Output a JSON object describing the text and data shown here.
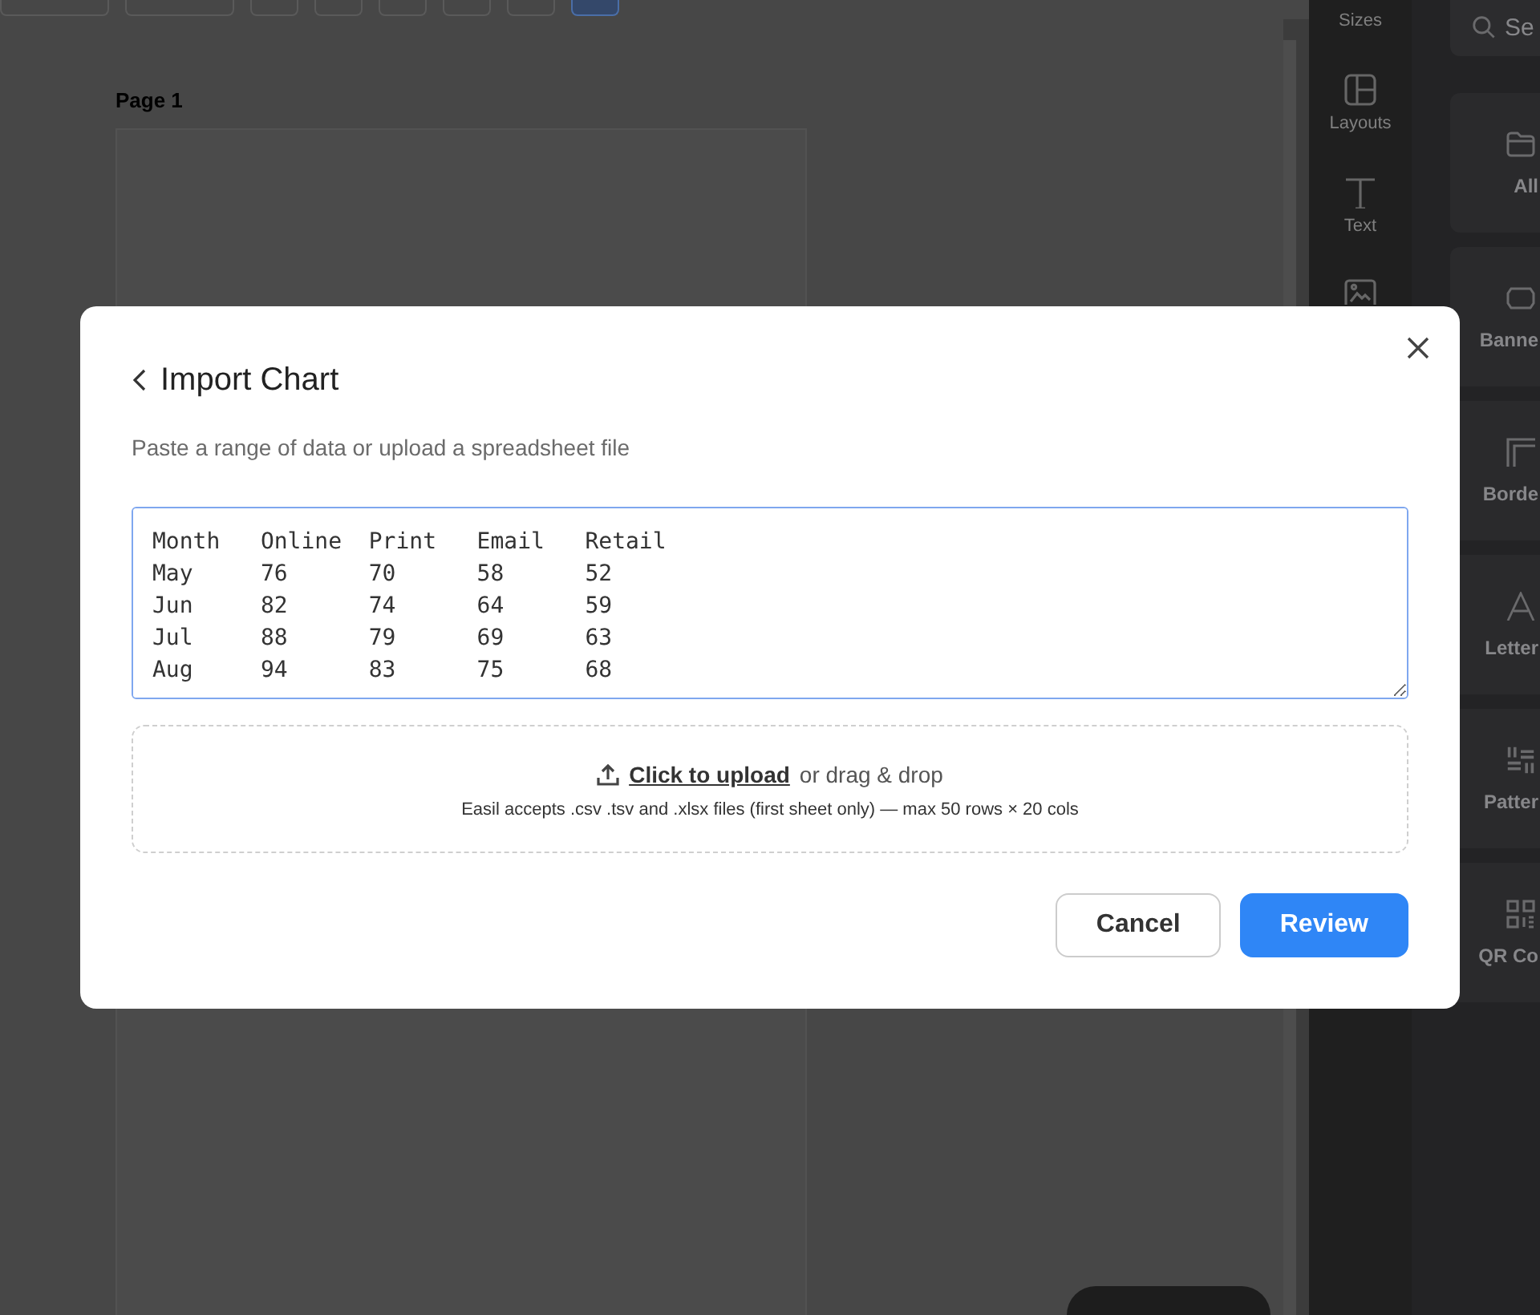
{
  "toolbar": {
    "buttons": [
      {
        "kind": "dropdown",
        "selected": false
      },
      {
        "kind": "dropdown",
        "selected": false
      },
      {
        "kind": "icon",
        "selected": false
      },
      {
        "kind": "icon",
        "selected": false
      },
      {
        "kind": "icon",
        "selected": false
      },
      {
        "kind": "icon",
        "selected": false
      },
      {
        "kind": "icon",
        "selected": false
      },
      {
        "kind": "icon",
        "selected": true
      }
    ]
  },
  "canvas": {
    "page_label": "Page 1"
  },
  "rail": {
    "items": [
      {
        "kind": "label_only",
        "label": "Sizes"
      },
      {
        "kind": "icon_label",
        "label": "Layouts"
      },
      {
        "kind": "icon_label",
        "label": "Text"
      },
      {
        "kind": "icon_only"
      }
    ]
  },
  "panel": {
    "search": {
      "placeholder": "Se"
    },
    "cards": [
      {
        "label": "All"
      },
      {
        "label": "Banne"
      },
      {
        "label": "Borde"
      },
      {
        "label": "Letter"
      },
      {
        "label": "Patter"
      },
      {
        "label": "QR Co"
      }
    ]
  },
  "dialog": {
    "title": "Import Chart",
    "subtitle": "Paste a range of data or upload a spreadsheet file",
    "data_field": {
      "value": "Month\tOnline\tPrint\tEmail\tRetail\nMay\t76\t70\t58\t52\nJun\t82\t74\t64\t59\nJul\t88\t79\t69\t63\nAug\t94\t83\t75\t68",
      "focused": true
    },
    "upload": {
      "link": "Click to upload",
      "text": "or drag & drop",
      "note": "Easil accepts .csv .tsv and .xlsx files (first sheet only) — max 50 rows × 20 cols"
    },
    "buttons": [
      {
        "label": "Cancel",
        "kind": "secondary"
      },
      {
        "label": "Review",
        "kind": "primary"
      }
    ]
  }
}
